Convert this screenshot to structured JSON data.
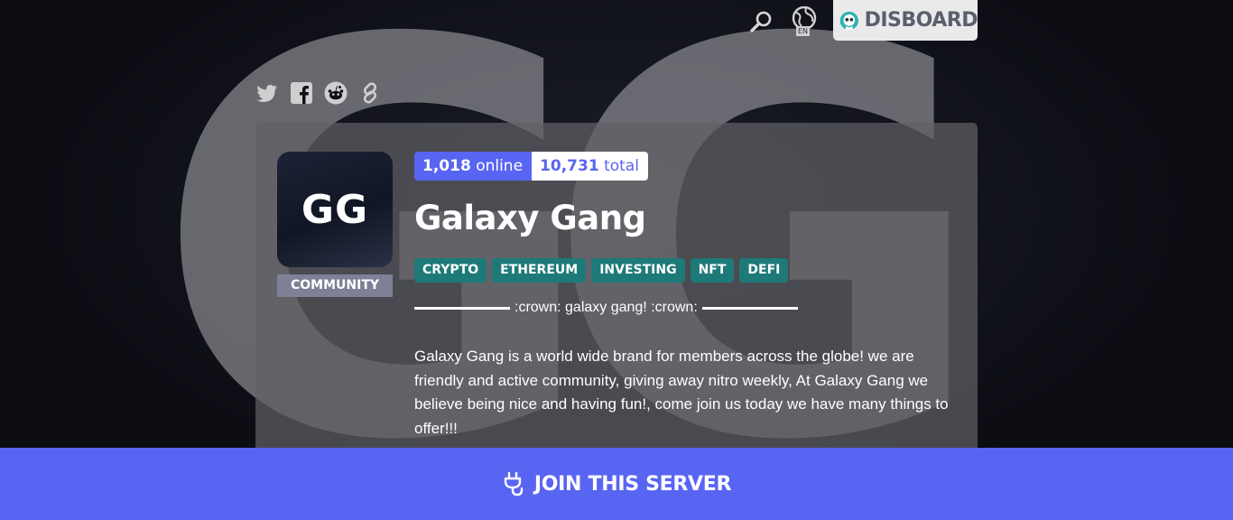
{
  "header": {
    "language": "EN",
    "brand": "DISBOARD"
  },
  "share": {
    "icons": [
      "twitter-icon",
      "facebook-icon",
      "reddit-icon",
      "link-icon"
    ]
  },
  "server": {
    "background_letters": "GG",
    "icon_text": "GG",
    "category": "COMMUNITY",
    "online_count": "1,018",
    "online_label": "online",
    "total_count": "10,731",
    "total_label": "total",
    "name": "Galaxy Gang",
    "tags": [
      "CRYPTO",
      "ETHEREUM",
      "INVESTING",
      "NFT",
      "DEFI"
    ],
    "tagline": ":crown: galaxy gang! :crown:",
    "description": "Galaxy Gang is a world wide brand for members across the globe! we are friendly and active community, giving away nitro weekly, At Galaxy Gang we believe being nice and having fun!, come join us today we have many things to offer!!!"
  },
  "join": {
    "label": "JOIN THIS SERVER"
  },
  "colors": {
    "accent": "#5865f2",
    "tag": "#1d7a78",
    "category": "#7e8196"
  }
}
